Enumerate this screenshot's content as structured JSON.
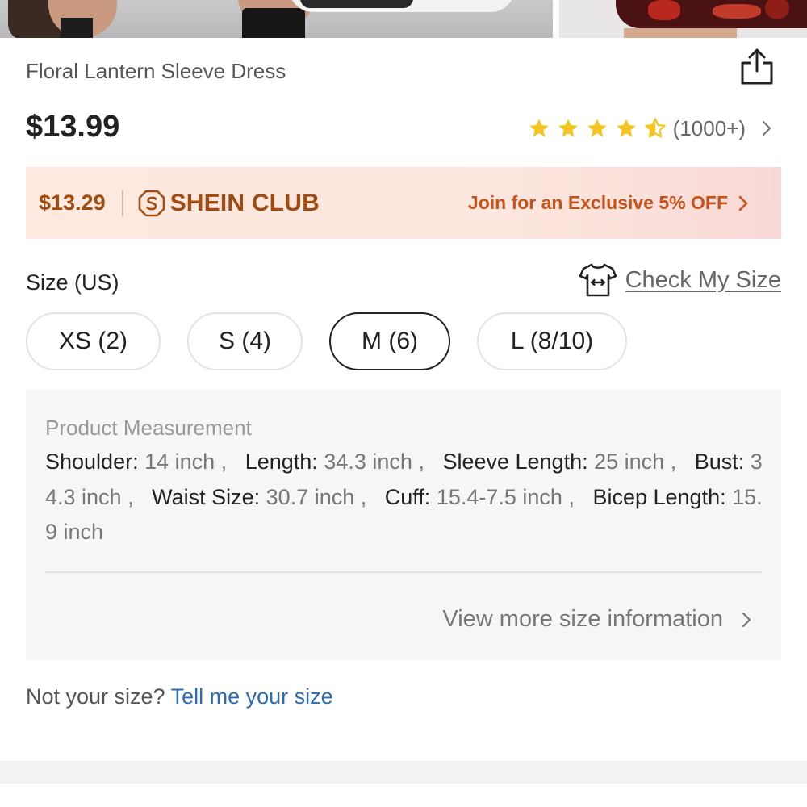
{
  "product": {
    "title": "Floral Lantern Sleeve Dress",
    "price": "$13.99",
    "rating": {
      "stars": 4.5,
      "count": "(1000+)"
    }
  },
  "club": {
    "price": "$13.29",
    "name": "SHEIN CLUB",
    "cta": "Join for an Exclusive 5% OFF"
  },
  "size": {
    "label": "Size (US)",
    "check_label": "Check My Size",
    "options": [
      "XS (2)",
      "S (4)",
      "M (6)",
      "L (8/10)"
    ],
    "selected": "M (6)"
  },
  "measurement": {
    "title": "Product Measurement",
    "items": [
      {
        "label": "Shoulder:",
        "value": "14 inch"
      },
      {
        "label": "Length:",
        "value": "34.3 inch"
      },
      {
        "label": "Sleeve Length:",
        "value": "25 inch"
      },
      {
        "label": "Bust:",
        "value": "34.3 inch"
      },
      {
        "label": "Waist Size:",
        "value": "30.7 inch"
      },
      {
        "label": "Cuff:",
        "value": "15.4-7.5 inch"
      },
      {
        "label": "Bicep Length:",
        "value": "15.9 inch"
      }
    ],
    "more_label": "View more size information"
  },
  "fit_prompt": {
    "text": "Not your size?",
    "link": "Tell me your size"
  },
  "colors": {
    "star": "#f7c41f",
    "club_text": "#a24b10",
    "club_cta": "#c8531a",
    "link": "#2c6bb0"
  }
}
